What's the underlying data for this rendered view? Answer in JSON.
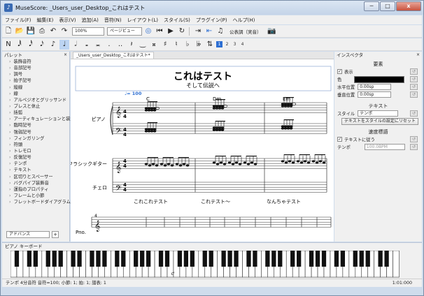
{
  "window": {
    "title": "MuseScore: _Users_user_Desktop_これはテスト",
    "min": "─",
    "max": "□",
    "close": "x"
  },
  "menu": [
    "ファイル(F)",
    "編集(E)",
    "表示(V)",
    "追加(A)",
    "音符(N)",
    "レイアウト(L)",
    "スタイル(S)",
    "プラグイン(P)",
    "ヘルプ(H)"
  ],
  "toolbar": {
    "zoom": "100%",
    "view_mode": "ページビュー",
    "concert_pitch": "公表調（実音）",
    "voices": [
      "1",
      "2",
      "3",
      "4"
    ]
  },
  "palette": {
    "title": "パレット",
    "items": [
      "装飾音符",
      "音部記号",
      "調号",
      "拍子記号",
      "縦線",
      "線",
      "アルペジオとグリッサンド",
      "ブレスと休止",
      "括弧",
      "アーティキュレーションと装飾",
      "臨時記号",
      "強弱記号",
      "フィンガリング",
      "符頭",
      "トレモロ",
      "反復記号",
      "テンポ",
      "テキスト",
      "区切りとスペーサー",
      "バグパイプ装飾音",
      "運指のプロパティ",
      "フレームと小節",
      "フレットボードダイアグラム"
    ],
    "mode": "アドバンス"
  },
  "score": {
    "tab": "_Users_user_Desktop_これはテスト*",
    "title": "これはテスト",
    "subtitle": "そして伝説へ",
    "tempo": "♩= 100",
    "chords": [
      "C",
      "Dm",
      "Em"
    ],
    "instruments": [
      "ピアノ",
      "クラシックギター",
      "チェロ"
    ],
    "lyrics": [
      "これこれテスト",
      "これテスト～",
      "なんちゃテスト"
    ],
    "second_system": {
      "instrument": "Pno.",
      "measure": "4"
    }
  },
  "inspector": {
    "title": "インスペクタ",
    "element_header": "要素",
    "visible_label": "表示",
    "color_label": "色",
    "hpos_label": "水平位置",
    "hpos_value": "0.00sp",
    "vpos_label": "垂直位置",
    "vpos_value": "0.00sp",
    "text_header": "テキスト",
    "style_label": "スタイル",
    "style_value": "テンポ",
    "reset_style_btn": "テキストをスタイルの設定にリセット",
    "tempo_header": "速度標語",
    "follow_text_label": "テキストに従う",
    "tempo_label": "テンポ",
    "tempo_value": "100.0BPM"
  },
  "piano_keyboard": {
    "title": "ピアノ キーボード",
    "c_label": "c'"
  },
  "status": {
    "left": "テンポ 4分音符 音符=100; 小節: 1; 拍: 1; 譜表: 1",
    "right": "1:01:000"
  }
}
